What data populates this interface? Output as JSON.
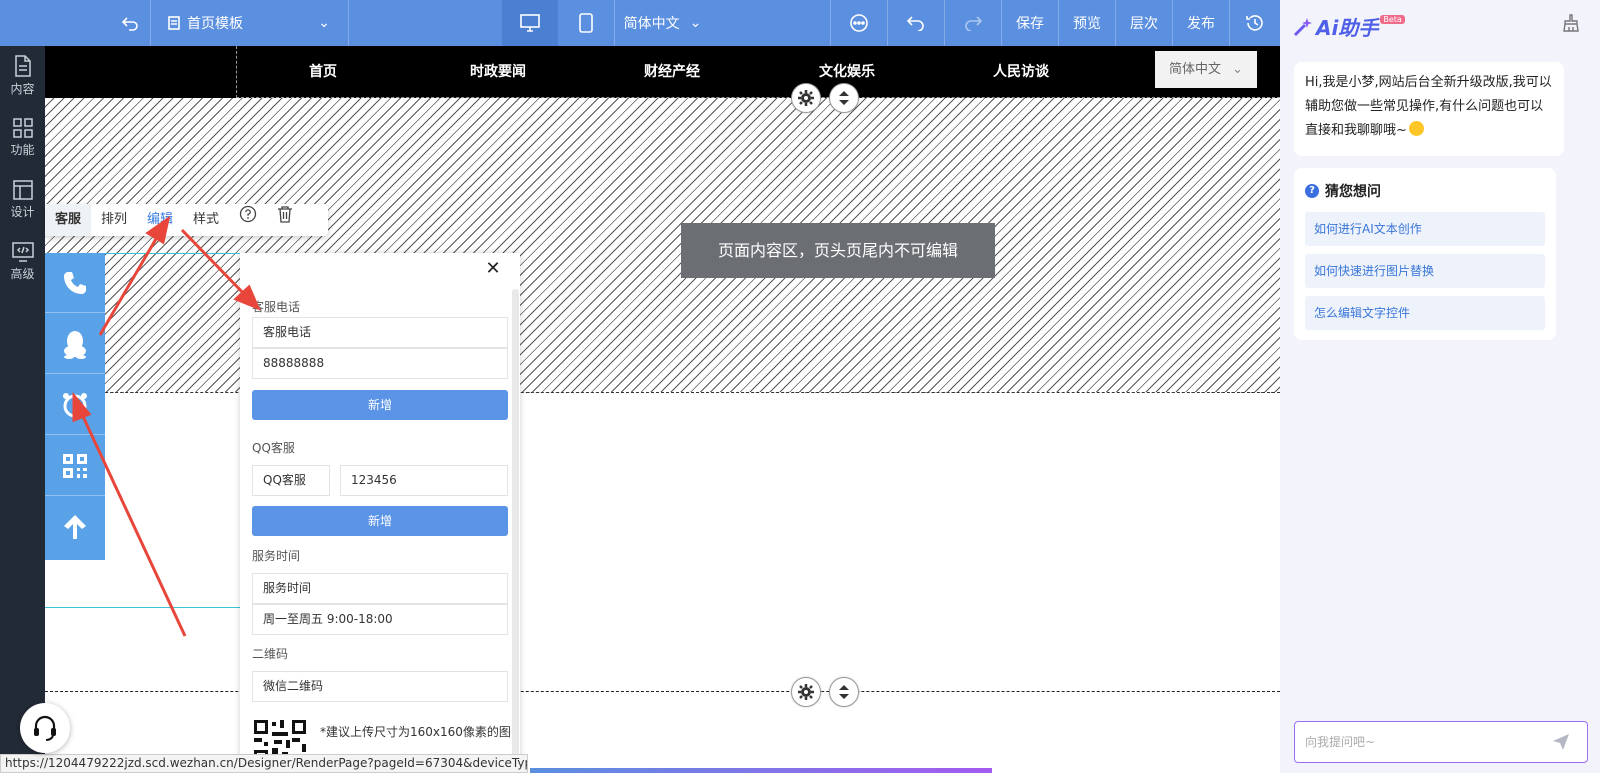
{
  "topbar": {
    "template_label": "首页模板",
    "language": "简体中文",
    "save": "保存",
    "preview": "预览",
    "layers": "层次",
    "publish": "发布",
    "accent_color": "#5b8fdf"
  },
  "leftnav": {
    "items": [
      {
        "label": "内容",
        "icon": "document-icon"
      },
      {
        "label": "功能",
        "icon": "grid-icon"
      },
      {
        "label": "设计",
        "icon": "layout-icon"
      },
      {
        "label": "高级",
        "icon": "code-monitor-icon"
      }
    ]
  },
  "site_header": {
    "nav": [
      "首页",
      "时政要闻",
      "财经产经",
      "文化娱乐",
      "人民访谈"
    ],
    "language_select": "简体中文"
  },
  "notice": "页面内容区，页头页尾内不可编辑",
  "widget_toolbar": {
    "items": [
      "客服",
      "排列",
      "编辑",
      "样式"
    ]
  },
  "panel": {
    "phone": {
      "section_label": "客服电话",
      "name_value": "客服电话",
      "number_value": "88888888"
    },
    "add_label": "新增",
    "qq": {
      "section_label": "QQ客服",
      "name_value": "QQ客服",
      "number_value": "123456"
    },
    "service": {
      "section_label": "服务时间",
      "title_value": "服务时间",
      "time_value": "周一至周五 9:00-18:00"
    },
    "qrcode": {
      "section_label": "二维码",
      "name_value": "微信二维码",
      "hint": "*建议上传尺寸为160x160像素的图"
    }
  },
  "statusbar_url": "https://1204479222jzd.scd.wezhan.cn/Designer/RenderPage?pageId=67304&deviceType...",
  "ai": {
    "title": "Ai助手",
    "badge": "Beta",
    "greeting": "Hi,我是小梦,网站后台全新升级改版,我可以辅助您做一些常见操作,有什么问题也可以直接和我聊聊哦~",
    "guess_title": "猜您想问",
    "questions": [
      "如何进行AI文本创作",
      "如何快速进行图片替换",
      "怎么编辑文字控件"
    ],
    "input_placeholder": "向我提问吧~"
  }
}
